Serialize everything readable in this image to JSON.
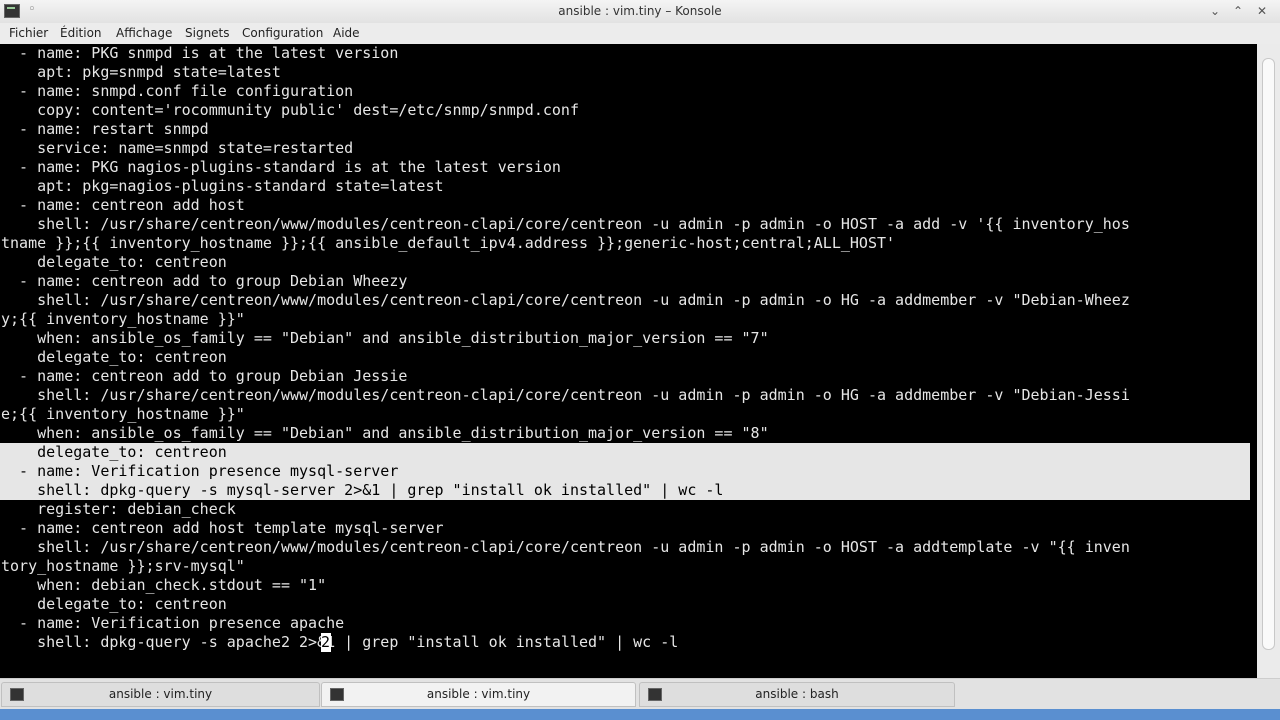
{
  "window": {
    "title": "ansible : vim.tiny – Konsole"
  },
  "menubar": {
    "items": [
      "Fichier",
      "Édition",
      "Affichage",
      "Signets",
      "Configuration",
      "Aide"
    ]
  },
  "terminal": {
    "lines": [
      "  - name: PKG snmpd is at the latest version",
      "    apt: pkg=snmpd state=latest",
      "  - name: snmpd.conf file configuration",
      "    copy: content='rocommunity public' dest=/etc/snmp/snmpd.conf",
      "  - name: restart snmpd",
      "    service: name=snmpd state=restarted",
      "  - name: PKG nagios-plugins-standard is at the latest version",
      "    apt: pkg=nagios-plugins-standard state=latest",
      "  - name: centreon add host",
      "    shell: /usr/share/centreon/www/modules/centreon-clapi/core/centreon -u admin -p admin -o HOST -a add -v '{{ inventory_hos",
      "tname }};{{ inventory_hostname }};{{ ansible_default_ipv4.address }};generic-host;central;ALL_HOST'",
      "    delegate_to: centreon",
      "  - name: centreon add to group Debian Wheezy",
      "    shell: /usr/share/centreon/www/modules/centreon-clapi/core/centreon -u admin -p admin -o HG -a addmember -v \"Debian-Wheez",
      "y;{{ inventory_hostname }}\"",
      "    when: ansible_os_family == \"Debian\" and ansible_distribution_major_version == \"7\"",
      "    delegate_to: centreon",
      "  - name: centreon add to group Debian Jessie",
      "    shell: /usr/share/centreon/www/modules/centreon-clapi/core/centreon -u admin -p admin -o HG -a addmember -v \"Debian-Jessi",
      "e;{{ inventory_hostname }}\"",
      "    when: ansible_os_family == \"Debian\" and ansible_distribution_major_version == \"8\"",
      "    delegate_to: centreon",
      "  - name: Verification presence mysql-server",
      "    shell: dpkg-query -s mysql-server 2>&1 | grep \"install ok installed\" | wc -l",
      "    register: debian_check",
      "  - name: centreon add host template mysql-server",
      "    shell: /usr/share/centreon/www/modules/centreon-clapi/core/centreon -u admin -p admin -o HOST -a addtemplate -v \"{{ inven",
      "tory_hostname }};srv-mysql\"",
      "    when: debian_check.stdout == \"1\"",
      "    delegate_to: centreon",
      "  - name: Verification presence apache",
      "    shell: dpkg-query -s apache2 2>&1 | grep \"install ok installed\" | wc -l"
    ],
    "selected_line_indices": [
      21,
      22,
      23
    ],
    "cursor_char": "2"
  },
  "tabs": [
    {
      "label": "ansible : vim.tiny"
    },
    {
      "label": "ansible : vim.tiny"
    },
    {
      "label": "ansible : bash"
    }
  ]
}
